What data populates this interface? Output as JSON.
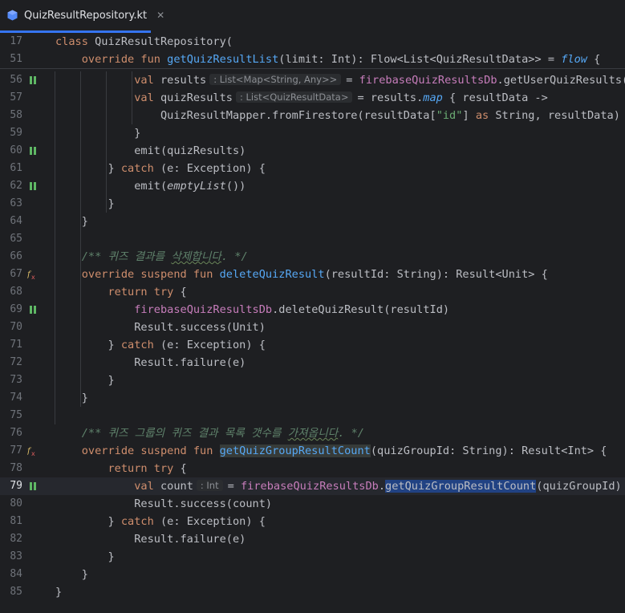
{
  "tab": {
    "filename": "QuizResultRepository.kt",
    "close": "✕",
    "icon": "kotlin-file-icon",
    "accent": "#3574f0"
  },
  "sticky": [
    {
      "ln": "17",
      "tokens": [
        {
          "t": "class ",
          "c": "kw"
        },
        {
          "t": "QuizResultRepository(",
          "c": "ty"
        }
      ]
    },
    {
      "ln": "51",
      "tokens": [
        {
          "t": "    override fun ",
          "c": "kw"
        },
        {
          "t": "getQuizResultList",
          "c": "fn"
        },
        {
          "t": "(limit: Int): Flow<List<QuizResultData>> = ",
          "c": "ty"
        },
        {
          "t": "flow",
          "c": "itfn"
        },
        {
          "t": " {",
          "c": "ty"
        }
      ]
    }
  ],
  "lines": [
    {
      "ln": "56",
      "gut": "pause",
      "tokens": [
        {
          "t": "            val ",
          "c": "kw"
        },
        {
          "t": "results",
          "c": "ty"
        },
        {
          "hint": "List<Map<String, Any>>"
        },
        {
          "t": "= ",
          "c": "ty"
        },
        {
          "t": "firebaseQuizResultsDb",
          "c": "pp"
        },
        {
          "t": ".getUserQuizResults(u",
          "c": "ty"
        }
      ]
    },
    {
      "ln": "57",
      "tokens": [
        {
          "t": "            val ",
          "c": "kw"
        },
        {
          "t": "quizResults",
          "c": "ty"
        },
        {
          "hint": "List<QuizResultData>"
        },
        {
          "t": "= results.",
          "c": "ty"
        },
        {
          "t": "map",
          "c": "itfn"
        },
        {
          "t": " { resultData ->",
          "c": "ty"
        }
      ]
    },
    {
      "ln": "58",
      "tokens": [
        {
          "t": "                QuizResultMapper.fromFirestore(resultData[",
          "c": "ty"
        },
        {
          "t": "\"id\"",
          "c": "str"
        },
        {
          "t": "] ",
          "c": "ty"
        },
        {
          "t": "as ",
          "c": "kw"
        },
        {
          "t": "String, resultData)",
          "c": "ty"
        }
      ]
    },
    {
      "ln": "59",
      "tokens": [
        {
          "t": "            }",
          "c": "ty"
        }
      ]
    },
    {
      "ln": "60",
      "gut": "pause",
      "tokens": [
        {
          "t": "            emit(quizResults)",
          "c": "ty"
        }
      ]
    },
    {
      "ln": "61",
      "tokens": [
        {
          "t": "        } ",
          "c": "ty"
        },
        {
          "t": "catch ",
          "c": "kw"
        },
        {
          "t": "(e: Exception) {",
          "c": "ty"
        }
      ]
    },
    {
      "ln": "62",
      "gut": "pause",
      "tokens": [
        {
          "t": "            emit(",
          "c": "ty"
        },
        {
          "t": "emptyList",
          "c": "it"
        },
        {
          "t": "())",
          "c": "ty"
        }
      ]
    },
    {
      "ln": "63",
      "tokens": [
        {
          "t": "        }",
          "c": "ty"
        }
      ]
    },
    {
      "ln": "64",
      "tokens": [
        {
          "t": "    }",
          "c": "ty"
        }
      ]
    },
    {
      "ln": "65",
      "tokens": []
    },
    {
      "ln": "66",
      "tokens": [
        {
          "t": "    /** 퀴즈 결과를 ",
          "c": "cm"
        },
        {
          "t": "삭제합니다",
          "c": "cm typo"
        },
        {
          "t": ". */",
          "c": "cm"
        }
      ]
    },
    {
      "ln": "67",
      "gut": "fx",
      "tokens": [
        {
          "t": "    override suspend fun ",
          "c": "kw"
        },
        {
          "t": "deleteQuizResult",
          "c": "fn"
        },
        {
          "t": "(resultId: String): Result<Unit> {",
          "c": "ty"
        }
      ]
    },
    {
      "ln": "68",
      "tokens": [
        {
          "t": "        return try ",
          "c": "kw"
        },
        {
          "t": "{",
          "c": "ty"
        }
      ]
    },
    {
      "ln": "69",
      "gut": "pause",
      "tokens": [
        {
          "t": "            ",
          "c": "ty"
        },
        {
          "t": "firebaseQuizResultsDb",
          "c": "pp"
        },
        {
          "t": ".deleteQuizResult(resultId)",
          "c": "ty"
        }
      ]
    },
    {
      "ln": "70",
      "tokens": [
        {
          "t": "            Result.success(Unit)",
          "c": "ty"
        }
      ]
    },
    {
      "ln": "71",
      "tokens": [
        {
          "t": "        } ",
          "c": "ty"
        },
        {
          "t": "catch ",
          "c": "kw"
        },
        {
          "t": "(e: Exception) {",
          "c": "ty"
        }
      ]
    },
    {
      "ln": "72",
      "tokens": [
        {
          "t": "            Result.failure(e)",
          "c": "ty"
        }
      ]
    },
    {
      "ln": "73",
      "tokens": [
        {
          "t": "        }",
          "c": "ty"
        }
      ]
    },
    {
      "ln": "74",
      "tokens": [
        {
          "t": "    }",
          "c": "ty"
        }
      ]
    },
    {
      "ln": "75",
      "tokens": []
    },
    {
      "ln": "76",
      "tokens": [
        {
          "t": "    /** 퀴즈 그룹의 퀴즈 결과 목록 갯수를 ",
          "c": "cm"
        },
        {
          "t": "가져옵니다",
          "c": "cm typo"
        },
        {
          "t": ". */",
          "c": "cm"
        }
      ]
    },
    {
      "ln": "77",
      "gut": "fx",
      "tokens": [
        {
          "t": "    override suspend fun ",
          "c": "kw"
        },
        {
          "t": "getQuizGroupResultCount",
          "c": "fn hl2"
        },
        {
          "t": "(quizGroupId: String): Result<Int> {",
          "c": "ty"
        }
      ]
    },
    {
      "ln": "78",
      "tokens": [
        {
          "t": "        return try ",
          "c": "kw"
        },
        {
          "t": "{",
          "c": "ty"
        }
      ]
    },
    {
      "ln": "79",
      "gut": "pause",
      "current": true,
      "tokens": [
        {
          "t": "            val ",
          "c": "kw"
        },
        {
          "t": "count",
          "c": "ty"
        },
        {
          "hint": "Int"
        },
        {
          "t": "= ",
          "c": "ty"
        },
        {
          "t": "firebaseQuizResultsDb",
          "c": "pp"
        },
        {
          "t": ".",
          "c": "ty"
        },
        {
          "t": "getQuizGroupResultCount",
          "c": "ty hl"
        },
        {
          "t": "(quizGroupId)",
          "c": "ty"
        }
      ]
    },
    {
      "ln": "80",
      "tokens": [
        {
          "t": "            Result.success(count)",
          "c": "ty"
        }
      ]
    },
    {
      "ln": "81",
      "tokens": [
        {
          "t": "        } ",
          "c": "ty"
        },
        {
          "t": "catch ",
          "c": "kw"
        },
        {
          "t": "(e: Exception) {",
          "c": "ty"
        }
      ]
    },
    {
      "ln": "82",
      "tokens": [
        {
          "t": "            Result.failure(e)",
          "c": "ty"
        }
      ]
    },
    {
      "ln": "83",
      "tokens": [
        {
          "t": "        }",
          "c": "ty"
        }
      ]
    },
    {
      "ln": "84",
      "tokens": [
        {
          "t": "    }",
          "c": "ty"
        }
      ]
    },
    {
      "ln": "85",
      "tokens": [
        {
          "t": "}",
          "c": "ty"
        }
      ]
    }
  ]
}
